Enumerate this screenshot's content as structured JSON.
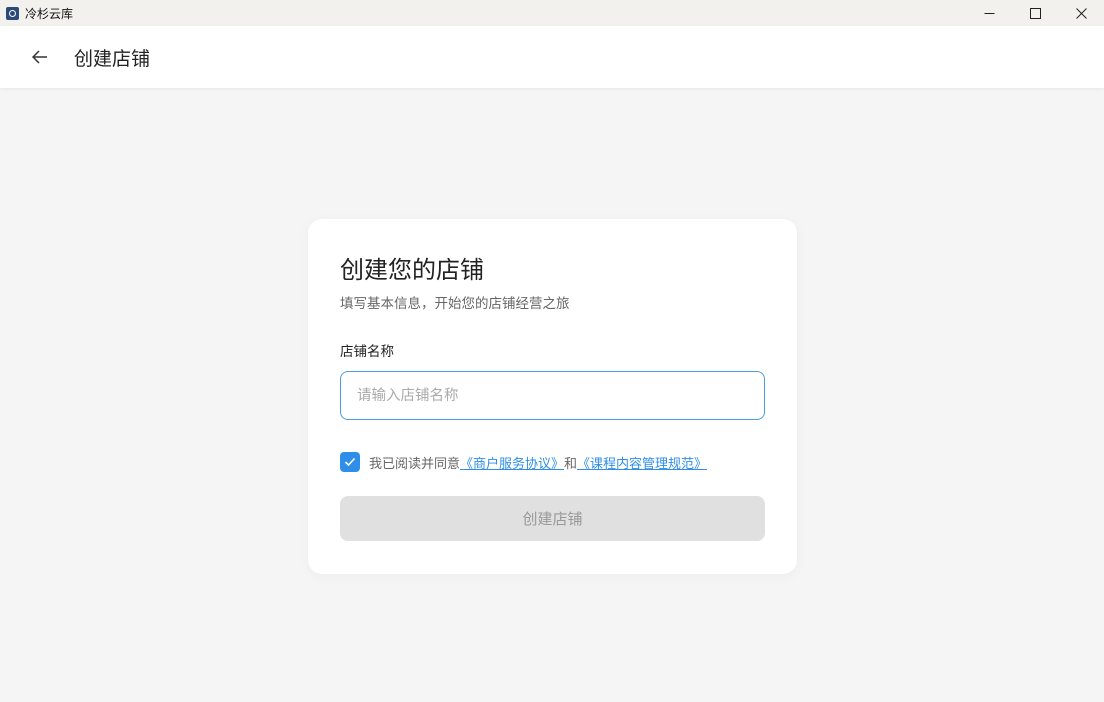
{
  "window": {
    "app_title": "冷杉云库",
    "icon": "app-logo-icon",
    "controls": [
      "minimize-icon",
      "maximize-icon",
      "close-icon"
    ]
  },
  "header": {
    "back_icon": "arrow-left-icon",
    "title": "创建店铺"
  },
  "card": {
    "title": "创建您的店铺",
    "subtitle": "填写基本信息，开始您的店铺经营之旅",
    "field": {
      "label": "店铺名称",
      "value": "",
      "placeholder": "请输入店铺名称"
    },
    "agreement": {
      "checked": true,
      "prefix": "我已阅读并同意",
      "link1": "《商户服务协议》",
      "joiner": "和",
      "link2": "《课程内容管理规范》"
    },
    "submit_label": "创建店铺"
  },
  "colors": {
    "accent": "#2e8ee8",
    "input_border": "#4a9ee0",
    "disabled_bg": "#e0e0e0",
    "page_bg": "#f5f5f5"
  }
}
